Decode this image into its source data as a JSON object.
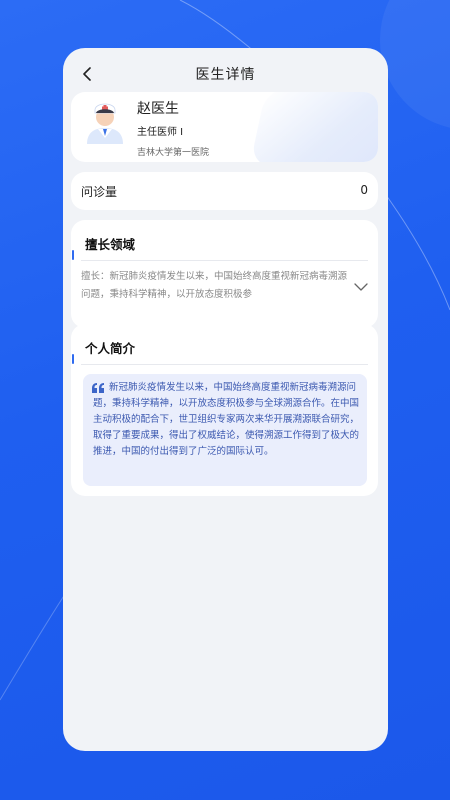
{
  "header": {
    "title": "医生详情"
  },
  "doctor": {
    "name": "赵医生",
    "title": "主任医师 I",
    "hospital": "吉林大学第一医院"
  },
  "consult": {
    "label": "问诊量",
    "value": "0"
  },
  "expertise": {
    "heading": "擅长领域",
    "text": "擅长：新冠肺炎疫情发生以来，中国始终高度重视新冠病毒溯源问题，秉持科学精神，以开放态度积极参"
  },
  "bio": {
    "heading": "个人简介",
    "text": "新冠肺炎疫情发生以来，中国始终高度重视新冠病毒溯源问题，秉持科学精神，以开放态度积极参与全球溯源合作。在中国主动积极的配合下，世卫组织专家两次来华开展溯源联合研究，取得了重要成果，得出了权威结论，使得溯源工作得到了极大的推进，中国的付出得到了广泛的国际认可。"
  },
  "colors": {
    "background": "#1f5ff0",
    "accent": "#2f6bf0",
    "quote_bg": "#eaeefc",
    "quote_text": "#3c59b0"
  },
  "icons": {
    "back": "chevron-left-icon",
    "expand": "chevron-down-icon",
    "quote": "quote-icon",
    "avatar": "doctor-avatar"
  }
}
